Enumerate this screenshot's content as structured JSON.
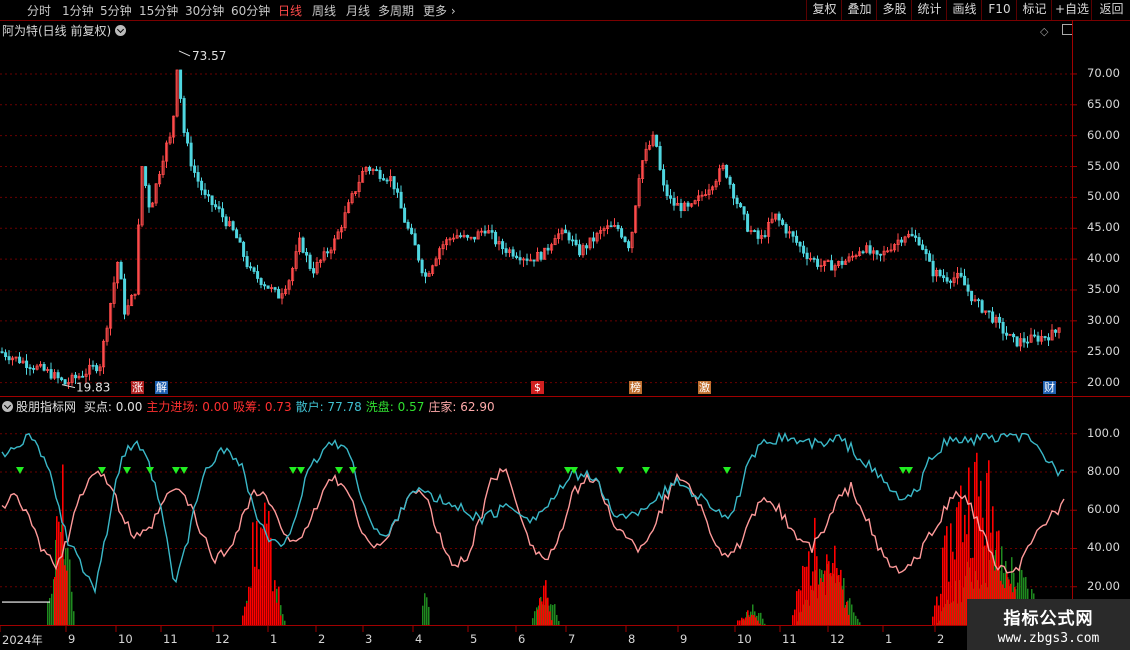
{
  "toolbar": {
    "periods": [
      "分时",
      "1分钟",
      "5分钟",
      "15分钟",
      "30分钟",
      "60分钟",
      "日线",
      "周线",
      "月线",
      "多周期",
      "更多"
    ],
    "active": "日线",
    "buttons": [
      "复权",
      "叠加",
      "多股",
      "统计",
      "画线",
      "F10",
      "标记",
      "+自选",
      "返回"
    ]
  },
  "main_title": "阿为特(日线 前复权)",
  "price_axis": [
    "70.00",
    "65.00",
    "60.00",
    "55.00",
    "50.00",
    "45.00",
    "40.00",
    "35.00",
    "30.00",
    "25.00",
    "20.00"
  ],
  "indicator_axis": [
    "100.0",
    "80.00",
    "60.00",
    "40.00",
    "20.00"
  ],
  "x_axis": [
    "2024年",
    "9",
    "10",
    "11",
    "12",
    "1",
    "2",
    "3",
    "4",
    "5",
    "6",
    "7",
    "8",
    "9",
    "10",
    "11",
    "12",
    "1",
    "2"
  ],
  "annotations": {
    "high": "73.57",
    "low": "19.83"
  },
  "markers": [
    {
      "text": "涨",
      "color": "#b02020"
    },
    {
      "text": "解",
      "color": "#2060b0"
    },
    {
      "text": "$",
      "color": "#d02020"
    },
    {
      "text": "榜",
      "color": "#c07030"
    },
    {
      "text": "激",
      "color": "#c07030"
    },
    {
      "text": "财",
      "color": "#2060b0"
    }
  ],
  "indicator": {
    "name": "股朋指标网",
    "items": [
      {
        "label": "买点: 0.00",
        "color": "#e0e0e0"
      },
      {
        "label": "主力进场: 0.00",
        "color": "#ff3030"
      },
      {
        "label": "吸筹: 0.73",
        "color": "#ff3030"
      },
      {
        "label": "散户: 77.78",
        "color": "#40c0d0"
      },
      {
        "label": "洗盘: 0.57",
        "color": "#30e030"
      },
      {
        "label": "庄家: 62.90",
        "color": "#ffaaaa"
      }
    ]
  },
  "watermark": {
    "line1": "指标公式网",
    "line2": "www.zbgs3.com"
  },
  "colors": {
    "up": "#ff4a4a",
    "down": "#4fd6e0",
    "grid": "#8b0000",
    "retail": "#3ab8c8",
    "dealer": "#ff9a9a",
    "main": "#ff0000",
    "wash": "#1f8a1f",
    "buy": "#22ee22"
  },
  "chart_data": {
    "type": "candlestick+indicator",
    "price_range": [
      17.5,
      75.5
    ],
    "price_series_anchors": [
      [
        0,
        25.0
      ],
      [
        50,
        21.5
      ],
      [
        65,
        19.83
      ],
      [
        100,
        23
      ],
      [
        118,
        40
      ],
      [
        125,
        31
      ],
      [
        135,
        35
      ],
      [
        142,
        55
      ],
      [
        150,
        48
      ],
      [
        165,
        58
      ],
      [
        172,
        60
      ],
      [
        178,
        73.57
      ],
      [
        182,
        62
      ],
      [
        192,
        55
      ],
      [
        205,
        50
      ],
      [
        218,
        48
      ],
      [
        235,
        44
      ],
      [
        250,
        38
      ],
      [
        265,
        36
      ],
      [
        278,
        34
      ],
      [
        290,
        37
      ],
      [
        300,
        43
      ],
      [
        312,
        38
      ],
      [
        322,
        40
      ],
      [
        335,
        43
      ],
      [
        352,
        50
      ],
      [
        365,
        55
      ],
      [
        378,
        54
      ],
      [
        392,
        53
      ],
      [
        405,
        46
      ],
      [
        415,
        42
      ],
      [
        425,
        37
      ],
      [
        440,
        42
      ],
      [
        455,
        44
      ],
      [
        470,
        43
      ],
      [
        485,
        45
      ],
      [
        500,
        42
      ],
      [
        515,
        41
      ],
      [
        530,
        40
      ],
      [
        545,
        41
      ],
      [
        555,
        44
      ],
      [
        568,
        44
      ],
      [
        578,
        41
      ],
      [
        592,
        43
      ],
      [
        605,
        45
      ],
      [
        618,
        45
      ],
      [
        630,
        42
      ],
      [
        640,
        55
      ],
      [
        648,
        58
      ],
      [
        655,
        60
      ],
      [
        662,
        52
      ],
      [
        672,
        49
      ],
      [
        690,
        48
      ],
      [
        705,
        51
      ],
      [
        715,
        53
      ],
      [
        724,
        55
      ],
      [
        735,
        50
      ],
      [
        748,
        45
      ],
      [
        760,
        43
      ],
      [
        775,
        47
      ],
      [
        790,
        44
      ],
      [
        805,
        41
      ],
      [
        820,
        39
      ],
      [
        835,
        39
      ],
      [
        850,
        40
      ],
      [
        862,
        42
      ],
      [
        878,
        40
      ],
      [
        890,
        42
      ],
      [
        905,
        44
      ],
      [
        920,
        43
      ],
      [
        932,
        38
      ],
      [
        945,
        37
      ],
      [
        960,
        37
      ],
      [
        975,
        33
      ],
      [
        990,
        31
      ],
      [
        1005,
        28
      ],
      [
        1015,
        26.5
      ],
      [
        1030,
        27
      ],
      [
        1045,
        27.5
      ],
      [
        1055,
        28
      ],
      [
        1063,
        31
      ]
    ],
    "indicator_range": [
      0,
      115
    ],
    "retail_line": [
      88,
      95,
      98,
      90,
      70,
      42,
      32,
      20,
      52,
      88,
      95,
      85,
      60,
      20,
      45,
      75,
      88,
      92,
      85,
      60,
      45,
      40,
      55,
      78,
      90,
      96,
      92,
      70,
      50,
      45,
      60,
      72,
      68,
      65,
      62,
      60,
      55,
      58,
      62,
      60,
      55,
      62,
      70,
      78,
      80,
      72,
      60,
      55,
      60,
      65,
      70,
      75,
      70,
      65,
      60,
      55,
      80,
      92,
      97,
      99,
      96,
      95,
      94,
      98,
      92,
      85,
      78,
      70,
      65,
      70,
      88,
      95,
      97,
      96,
      99,
      97,
      98,
      99,
      92,
      85,
      78
    ],
    "dealer_line": [
      60,
      72,
      55,
      40,
      30,
      45,
      70,
      82,
      75,
      58,
      45,
      48,
      62,
      72,
      65,
      48,
      35,
      38,
      55,
      70,
      66,
      50,
      45,
      48,
      68,
      78,
      70,
      52,
      40,
      44,
      60,
      72,
      65,
      45,
      30,
      35,
      55,
      78,
      80,
      60,
      40,
      34,
      45,
      68,
      78,
      72,
      55,
      45,
      40,
      50,
      66,
      78,
      72,
      55,
      40,
      35,
      48,
      62,
      66,
      55,
      45,
      40,
      50,
      66,
      72,
      58,
      40,
      30,
      28,
      35,
      48,
      60,
      70,
      62,
      45,
      30,
      25,
      35,
      48,
      58,
      63
    ],
    "buy_signal_x": [
      20,
      102,
      127,
      150,
      176,
      184,
      293,
      301,
      339,
      353,
      568,
      574,
      620,
      646,
      727,
      903,
      909
    ]
  }
}
